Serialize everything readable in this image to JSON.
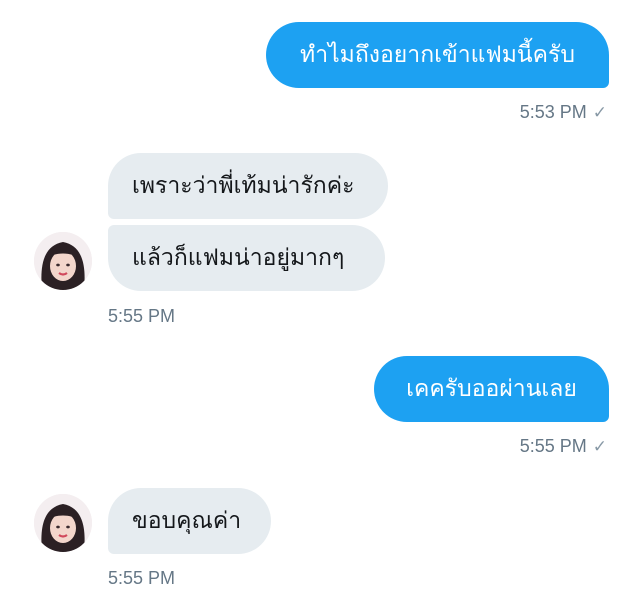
{
  "conversation": {
    "messages": [
      {
        "direction": "sent",
        "text": "ทำไมถึงอยากเข้าแฟมนี้ครับ",
        "time": "5:53 PM",
        "status": "seen-check-icon"
      },
      {
        "direction": "received",
        "texts": [
          "เพราะว่าพี่เท้มน่ารักค่ะ",
          "แล้วก็แฟมน่าอยู่มากๆ"
        ],
        "time": "5:55 PM"
      },
      {
        "direction": "sent",
        "text": "เคครับออผ่านเลย",
        "time": "5:55 PM",
        "status": "seen-check-icon"
      },
      {
        "direction": "received",
        "texts": [
          "ขอบคุณค่า"
        ],
        "time": "5:55 PM"
      }
    ],
    "check_glyph": "✓",
    "colors": {
      "sent_bubble": "#1da1f2",
      "received_bubble": "#e6ecf0",
      "timestamp": "#657786"
    }
  }
}
